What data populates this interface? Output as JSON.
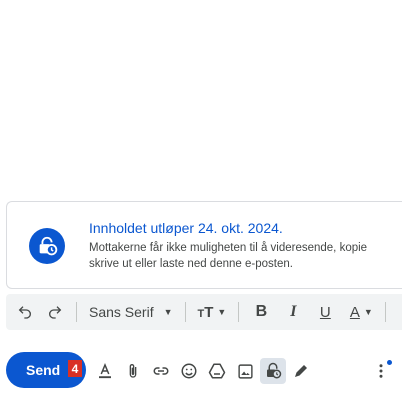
{
  "confidential": {
    "title": "Innholdet utløper 24. okt. 2024.",
    "line1": "Mottakerne får ikke muligheten til å videresende, kopie",
    "line2": "skrive ut eller laste ned denne e-posten.",
    "icon": "lock-clock-icon"
  },
  "format_toolbar": {
    "font": "Sans Serif",
    "bold": "B",
    "italic": "I",
    "underline": "U",
    "text_color": "A",
    "icons": [
      "undo-icon",
      "redo-icon",
      "font-size-icon",
      "chevron-down-icon"
    ]
  },
  "actions": {
    "send_label": "Send",
    "badge": "4",
    "icons": [
      "formatting-icon",
      "attach-icon",
      "link-icon",
      "emoji-icon",
      "drive-icon",
      "photo-icon",
      "confidential-mode-icon",
      "signature-icon",
      "more-options-icon"
    ]
  },
  "colors": {
    "accent": "#0b57d0",
    "badge": "#d93025",
    "toolbar_bg": "#f1f3f4"
  }
}
